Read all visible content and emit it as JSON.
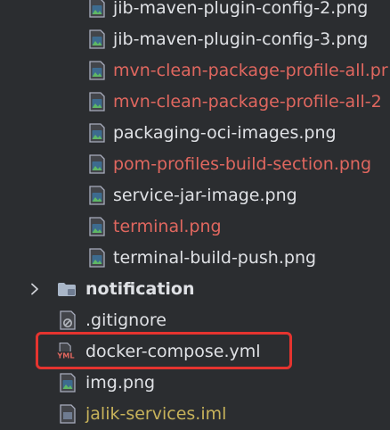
{
  "project_tree": {
    "items": [
      {
        "name": "jib-maven-plugin-config-2.png",
        "type": "image",
        "status": "default"
      },
      {
        "name": "jib-maven-plugin-config-3.png",
        "type": "image",
        "status": "default"
      },
      {
        "name": "mvn-clean-package-profile-all.pr",
        "type": "image",
        "status": "modified"
      },
      {
        "name": "mvn-clean-package-profile-all-2",
        "type": "image",
        "status": "modified"
      },
      {
        "name": "packaging-oci-images.png",
        "type": "image",
        "status": "default"
      },
      {
        "name": "pom-profiles-build-section.png",
        "type": "image",
        "status": "modified"
      },
      {
        "name": "service-jar-image.png",
        "type": "image",
        "status": "default"
      },
      {
        "name": "terminal.png",
        "type": "image",
        "status": "modified"
      },
      {
        "name": "terminal-build-push.png",
        "type": "image",
        "status": "default"
      },
      {
        "name": "notification",
        "type": "folder",
        "status": "default",
        "expanded": false
      },
      {
        "name": ".gitignore",
        "type": "gitignore",
        "status": "default"
      },
      {
        "name": "docker-compose.yml",
        "type": "yaml",
        "status": "default",
        "icon_text": "YML"
      },
      {
        "name": "img.png",
        "type": "image",
        "status": "default"
      },
      {
        "name": "jalik-services.iml",
        "type": "iml",
        "status": "unversioned"
      }
    ]
  },
  "colors": {
    "background": "#2b2d30",
    "text_default": "#dfe1e5",
    "text_modified": "#e0675f",
    "text_unversioned": "#c7b25a",
    "highlight_border": "#e5342f"
  }
}
